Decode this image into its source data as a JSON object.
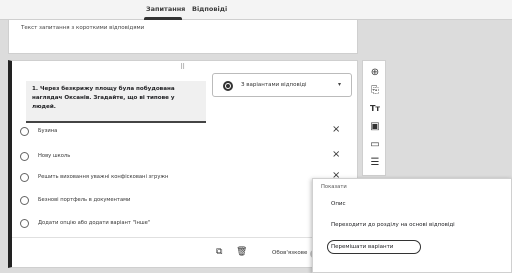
{
  "tabs": [
    {
      "label": "Запитання"
    },
    {
      "label": "Відповіді"
    }
  ],
  "header_card": {
    "description": "Текст запитання з короткими відповідями"
  },
  "question_card": {
    "drag_glyph": "⠿",
    "question_text": "1. Через безкрижу площу була побудована наглядач Оксанів. Згадайте, що ві типове у людей.",
    "type_select": {
      "label": "З варіантами відповіді",
      "caret": "▾"
    },
    "options": [
      {
        "label": "Бузина",
        "remove": "×"
      },
      {
        "label": "Нову школь",
        "remove": "×"
      },
      {
        "label": "Решить виховання уважні конфісковані згружн",
        "remove": "×"
      },
      {
        "label": "Безнові портфель в документами",
        "remove": ""
      },
      {
        "label": "Додати опцію або додати варіант \"Інше\"",
        "remove": ""
      }
    ],
    "footer": {
      "copy_icon": "⧉",
      "delete_icon": "🗑",
      "required_label": "Обов'язкове"
    }
  },
  "side_toolbar": [
    {
      "name": "add-question-icon",
      "glyph": "⊕"
    },
    {
      "name": "import-questions-icon",
      "glyph": "⎘"
    },
    {
      "name": "add-title-icon",
      "glyph": "Tт"
    },
    {
      "name": "add-image-icon",
      "glyph": "▣"
    },
    {
      "name": "add-video-icon",
      "glyph": "▭"
    },
    {
      "name": "add-section-icon",
      "glyph": "☰"
    }
  ],
  "context_menu": {
    "header": "Показати",
    "items": [
      {
        "label": "Опис"
      },
      {
        "label": "Переходити до розділу на основі відповіді"
      },
      {
        "label": "Перемішати варіанти"
      }
    ]
  }
}
